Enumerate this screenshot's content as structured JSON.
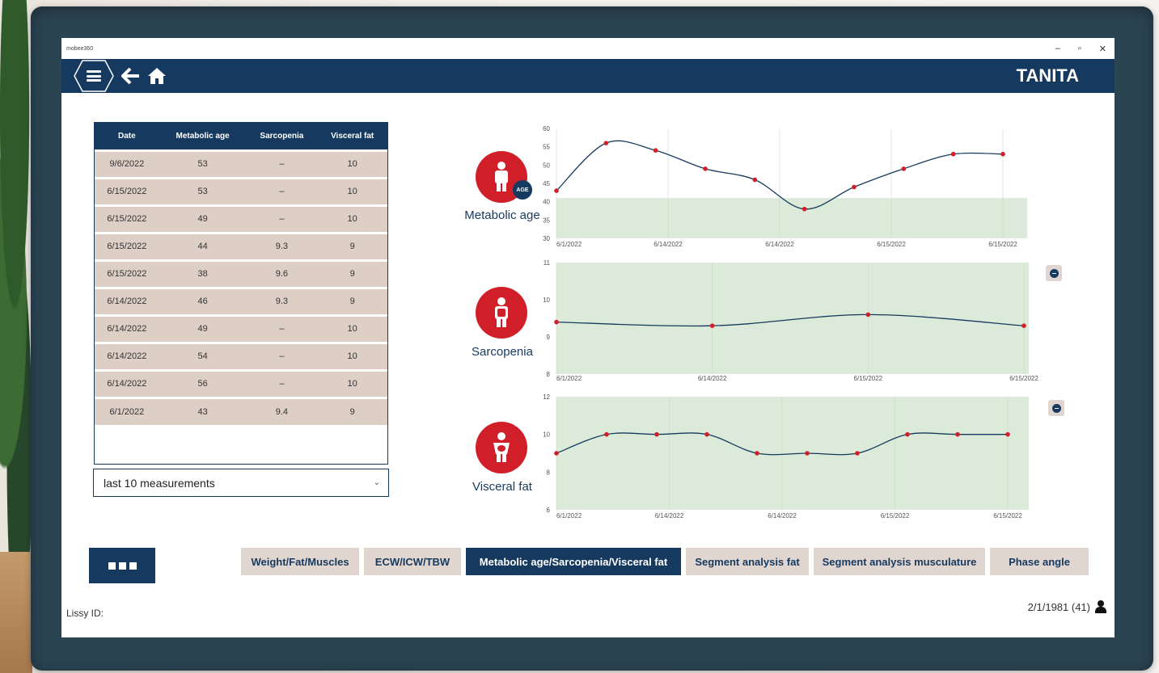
{
  "window": {
    "app_name": "mobee360",
    "controls": [
      "–",
      "▫",
      "✕"
    ]
  },
  "header": {
    "logo": "TANITA"
  },
  "table": {
    "columns": [
      "Date",
      "Metabolic age",
      "Sarcopenia",
      "Visceral fat"
    ],
    "rows": [
      [
        "9/6/2022",
        "53",
        "–",
        "10"
      ],
      [
        "6/15/2022",
        "53",
        "–",
        "10"
      ],
      [
        "6/15/2022",
        "49",
        "–",
        "10"
      ],
      [
        "6/15/2022",
        "44",
        "9.3",
        "9"
      ],
      [
        "6/15/2022",
        "38",
        "9.6",
        "9"
      ],
      [
        "6/14/2022",
        "46",
        "9.3",
        "9"
      ],
      [
        "6/14/2022",
        "49",
        "–",
        "10"
      ],
      [
        "6/14/2022",
        "54",
        "–",
        "10"
      ],
      [
        "6/14/2022",
        "56",
        "–",
        "10"
      ],
      [
        "6/1/2022",
        "43",
        "9.4",
        "9"
      ]
    ]
  },
  "dropdown": {
    "value": "last 10 measurements"
  },
  "charts": {
    "metabolic": {
      "label": "Metabolic age",
      "icon_badge": "AGE"
    },
    "sarcopenia": {
      "label": "Sarcopenia"
    },
    "visceral": {
      "label": "Visceral fat"
    }
  },
  "chart_data": [
    {
      "type": "line",
      "title": "Metabolic age",
      "x": [
        "6/1/2022",
        "",
        "6/14/2022",
        "",
        "6/14/2022",
        "",
        "6/15/2022",
        "",
        "6/15/2022",
        ""
      ],
      "xtick_labels": [
        "6/1/2022",
        "6/14/2022",
        "6/14/2022",
        "6/15/2022",
        "6/15/2022"
      ],
      "values": [
        43,
        56,
        54,
        49,
        46,
        38,
        44,
        49,
        53,
        53
      ],
      "ylim": [
        30,
        60
      ],
      "yticks": [
        30,
        35,
        40,
        45,
        50,
        55,
        60
      ],
      "target_band": [
        30,
        41
      ],
      "colors": {
        "line": "#163a5f",
        "point": "#d11f2a",
        "band": "#dcebd9"
      }
    },
    {
      "type": "line",
      "title": "Sarcopenia",
      "x": [
        "6/1/2022",
        "6/14/2022",
        "6/15/2022",
        "6/15/2022"
      ],
      "xtick_labels": [
        "6/1/2022",
        "6/14/2022",
        "6/15/2022",
        "6/15/2022"
      ],
      "values": [
        9.4,
        9.3,
        9.6,
        9.3
      ],
      "ylim": [
        8,
        11
      ],
      "yticks": [
        8,
        9,
        10,
        11
      ],
      "target_band": [
        8,
        11
      ],
      "colors": {
        "line": "#163a5f",
        "point": "#d11f2a",
        "band": "#dcebd9"
      }
    },
    {
      "type": "line",
      "title": "Visceral fat",
      "x": [
        "6/1/2022",
        "",
        "6/14/2022",
        "",
        "6/14/2022",
        "",
        "6/15/2022",
        "",
        "6/15/2022",
        ""
      ],
      "xtick_labels": [
        "6/1/2022",
        "6/14/2022",
        "6/14/2022",
        "6/15/2022",
        "6/15/2022"
      ],
      "values": [
        9,
        10,
        10,
        10,
        9,
        9,
        9,
        10,
        10,
        10
      ],
      "ylim": [
        6,
        12
      ],
      "yticks": [
        6,
        8,
        10,
        12
      ],
      "target_band": [
        6,
        12
      ],
      "colors": {
        "line": "#163a5f",
        "point": "#d11f2a",
        "band": "#dcebd9"
      }
    }
  ],
  "tabs": [
    {
      "label": "Weight/Fat/Muscles",
      "active": false
    },
    {
      "label": "ECW/ICW/TBW",
      "active": false
    },
    {
      "label": "Metabolic age/Sarcopenia/Visceral fat",
      "active": true
    },
    {
      "label": "Segment analysis fat",
      "active": false
    },
    {
      "label": "Segment analysis musculature",
      "active": false
    },
    {
      "label": "Phase angle",
      "active": false
    }
  ],
  "footer": {
    "lissy_label": "Lissy ID:",
    "birthdate": "2/1/1981 (41)"
  }
}
